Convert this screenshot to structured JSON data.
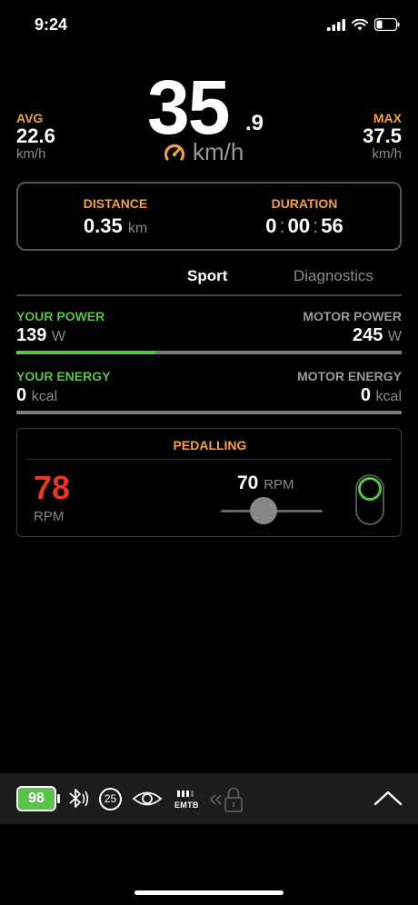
{
  "status_bar": {
    "time": "9:24",
    "icons": [
      "cellular-signal-icon",
      "wifi-icon",
      "battery-low-icon"
    ]
  },
  "speed": {
    "value": "35",
    "decimal": ".9",
    "unit": "km/h",
    "icon": "speedometer-icon",
    "avg": {
      "label": "AVG",
      "value": "22.6",
      "unit": "km/h"
    },
    "max": {
      "label": "MAX",
      "value": "37.5",
      "unit": "km/h"
    }
  },
  "trip": {
    "distance": {
      "label": "DISTANCE",
      "value": "0.35",
      "unit": "km"
    },
    "duration": {
      "label": "DURATION",
      "hours": "0",
      "minutes": "00",
      "seconds": "56"
    }
  },
  "tabs": [
    {
      "label": "Sport",
      "active": true
    },
    {
      "label": "Diagnostics",
      "active": false
    }
  ],
  "power": {
    "your_label": "YOUR POWER",
    "your_value": "139",
    "your_unit": "W",
    "motor_label": "MOTOR POWER",
    "motor_value": "245",
    "motor_unit": "W",
    "rider_share": 0.36
  },
  "energy": {
    "your_label": "YOUR ENERGY",
    "your_value": "0",
    "your_unit": "kcal",
    "motor_label": "MOTOR ENERGY",
    "motor_value": "0",
    "motor_unit": "kcal",
    "rider_share": 0
  },
  "pedalling": {
    "title": "PEDALLING",
    "cadence_value": "78",
    "cadence_unit": "RPM",
    "target_value": "70",
    "target_unit": "RPM",
    "slider_level": 0.4,
    "toggle_on": true
  },
  "bottom_bar": {
    "battery_percent": "98",
    "speed_limit": "25",
    "mode_label": "EMTB",
    "mode_level": 3,
    "mode_levels_total": 4,
    "icons": [
      "bluetooth-icon",
      "speed-limit-icon",
      "eye-icon",
      "mode-icon",
      "lock-icon",
      "chevron-up-icon"
    ]
  },
  "colors": {
    "accent_orange": "#f0a04a",
    "green": "#5cc04c",
    "red": "#e0392c",
    "background": "#000000"
  }
}
